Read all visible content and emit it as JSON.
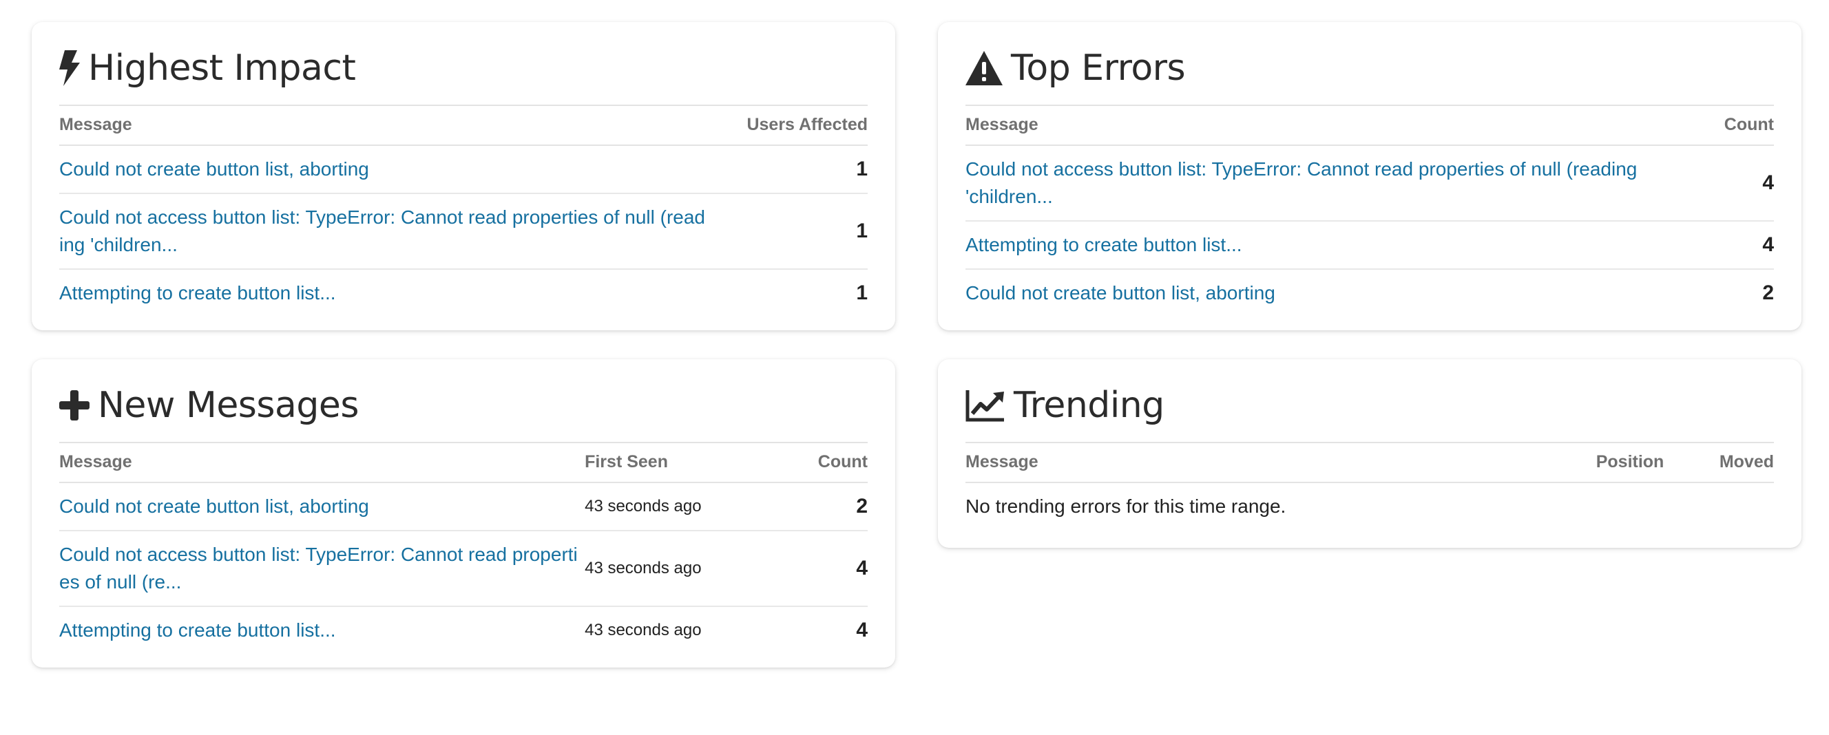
{
  "highest_impact": {
    "title": "Highest Impact",
    "icon": "bolt-icon",
    "columns": {
      "message": "Message",
      "users": "Users Affected"
    },
    "rows": [
      {
        "message": "Could not create button list, aborting",
        "users": "1"
      },
      {
        "message": "Could not access button list: TypeError: Cannot read properties of null (reading 'children...",
        "users": "1"
      },
      {
        "message": "Attempting to create button list...",
        "users": "1"
      }
    ]
  },
  "top_errors": {
    "title": "Top Errors",
    "icon": "warning-icon",
    "columns": {
      "message": "Message",
      "count": "Count"
    },
    "rows": [
      {
        "message": "Could not access button list: TypeError: Cannot read properties of null (reading 'children...",
        "count": "4"
      },
      {
        "message": "Attempting to create button list...",
        "count": "4"
      },
      {
        "message": "Could not create button list, aborting",
        "count": "2"
      }
    ]
  },
  "new_messages": {
    "title": "New Messages",
    "icon": "plus-icon",
    "columns": {
      "message": "Message",
      "first_seen": "First Seen",
      "count": "Count"
    },
    "rows": [
      {
        "message": "Could not create button list, aborting",
        "first_seen": "43 seconds ago",
        "count": "2"
      },
      {
        "message": "Could not access button list: TypeError: Cannot read properties of null (re...",
        "first_seen": "43 seconds ago",
        "count": "4"
      },
      {
        "message": "Attempting to create button list...",
        "first_seen": "43 seconds ago",
        "count": "4"
      }
    ]
  },
  "trending": {
    "title": "Trending",
    "icon": "trend-chart-icon",
    "columns": {
      "message": "Message",
      "position": "Position",
      "moved": "Moved"
    },
    "empty_text": "No trending errors for this time range."
  },
  "colors": {
    "link": "#1670a0",
    "heading": "#2b2b2b",
    "column_header": "#707070"
  }
}
